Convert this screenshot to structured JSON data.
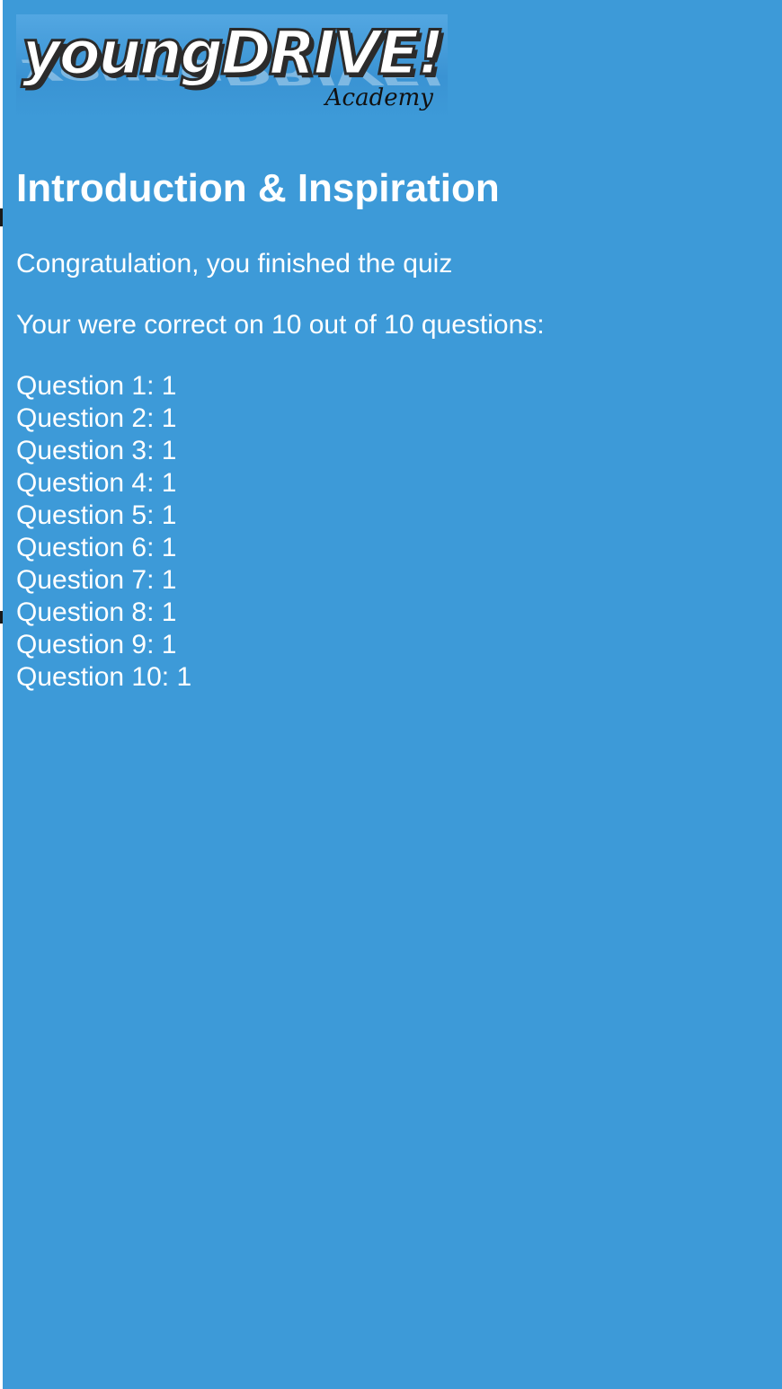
{
  "logo": {
    "main": "youngDRIVE!",
    "sub": "Academy"
  },
  "title": "Introduction & Inspiration",
  "congrats": "Congratulation, you finished the quiz",
  "summary": "Your were correct on 10 out of 10 questions:",
  "results": [
    {
      "label": "Question 1:",
      "value": "1"
    },
    {
      "label": "Question 2:",
      "value": "1"
    },
    {
      "label": "Question 3:",
      "value": "1"
    },
    {
      "label": "Question 4:",
      "value": "1"
    },
    {
      "label": "Question 5:",
      "value": "1"
    },
    {
      "label": "Question 6:",
      "value": "1"
    },
    {
      "label": "Question 7:",
      "value": "1"
    },
    {
      "label": "Question 8:",
      "value": "1"
    },
    {
      "label": "Question 9:",
      "value": "1"
    },
    {
      "label": "Question 10:",
      "value": "1"
    }
  ],
  "colors": {
    "background": "#3d9ad8",
    "text": "#ffffff"
  }
}
